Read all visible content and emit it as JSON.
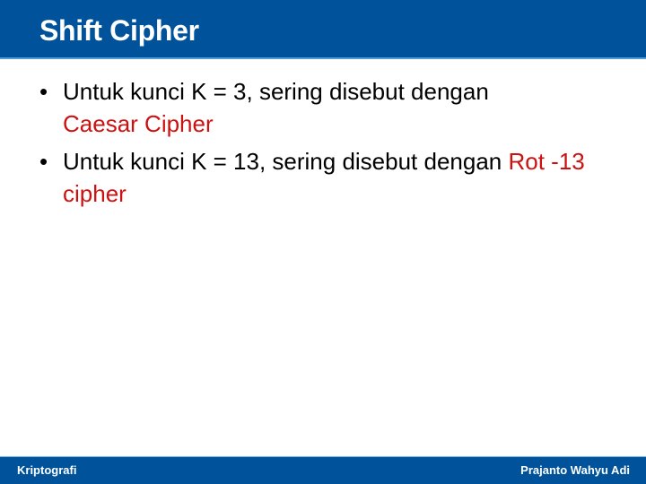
{
  "header": {
    "title": "Shift Cipher",
    "color": "#00539b"
  },
  "bullets": [
    {
      "marker": "•",
      "text": "Untuk  kunci  K  =  3,  sering  disebut  dengan",
      "highlight": "Caesar Cipher",
      "highlight_color": "#cc1111"
    },
    {
      "marker": "•",
      "text": "Untuk  kunci K = 13, sering disebut dengan ",
      "highlight": "Rot -13 cipher",
      "highlight_color": "#cc1111"
    }
  ],
  "footer": {
    "left": "Kriptografi",
    "right": "Prajanto Wahyu Adi"
  }
}
